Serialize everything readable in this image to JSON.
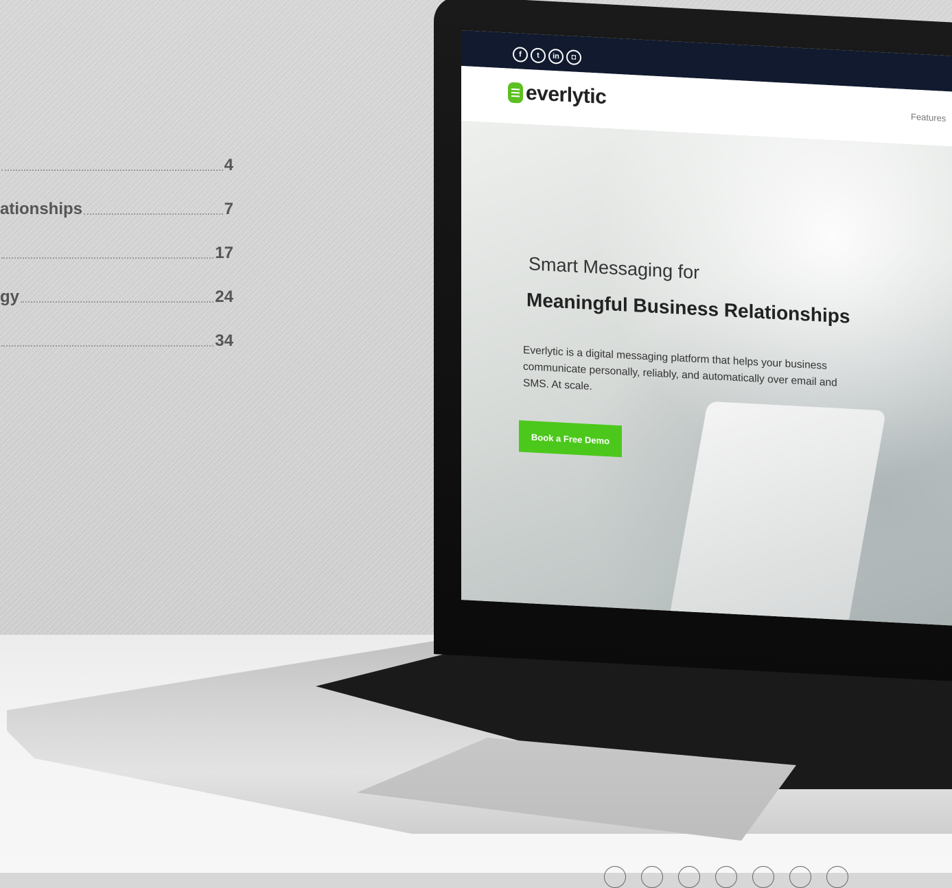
{
  "toc": [
    {
      "title": "",
      "page": "4"
    },
    {
      "title": "ationships",
      "page": "7"
    },
    {
      "title": "",
      "page": "17"
    },
    {
      "title": "gy",
      "page": "24"
    },
    {
      "title": "",
      "page": "34"
    }
  ],
  "website": {
    "social_icons": [
      "facebook-icon",
      "twitter-icon",
      "linkedin-icon",
      "instagram-icon"
    ],
    "logo_text": "everlytic",
    "nav_link": "Features",
    "headline_line1": "Smart Messaging for",
    "headline_line2": "Meaningful Business Relationships",
    "description": "Everlytic is a digital messaging platform that helps your business communicate personally, reliably, and automatically over email and SMS. At scale.",
    "cta_label": "Book a Free Demo",
    "colors": {
      "accent": "#4cc81c",
      "topbar": "#111a2e"
    }
  }
}
